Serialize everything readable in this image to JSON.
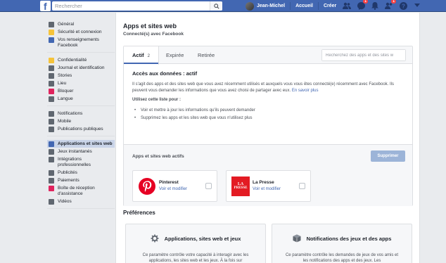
{
  "topbar": {
    "logo": "f",
    "search_placeholder": "Rechercher",
    "user_name": "Jean-Michel",
    "home": "Accueil",
    "create": "Créer",
    "icons": [
      "friends-icon",
      "messenger-icon",
      "notifications-icon",
      "help-icon",
      "menu-arrow-icon"
    ],
    "badge_messages": "1",
    "badge_notifications": "1"
  },
  "sidebar": {
    "groups": [
      [
        {
          "label": "Général",
          "icon": "gear-icon",
          "color": "#606770"
        },
        {
          "label": "Sécurité et connexion",
          "icon": "lock-icon",
          "color": "#f5c33b"
        },
        {
          "label": "Vos renseignements Facebook",
          "icon": "facebook-icon",
          "color": "#4267b2"
        }
      ],
      [
        {
          "label": "Confidentialité",
          "icon": "privacy-icon",
          "color": "#f5c33b"
        },
        {
          "label": "Journal et identification",
          "icon": "timeline-icon",
          "color": "#606770"
        },
        {
          "label": "Stories",
          "icon": "stories-icon",
          "color": "#606770"
        },
        {
          "label": "Lieu",
          "icon": "location-icon",
          "color": "#606770"
        },
        {
          "label": "Bloquer",
          "icon": "block-icon",
          "color": "#e0245e"
        },
        {
          "label": "Langue",
          "icon": "language-icon",
          "color": "#606770"
        }
      ],
      [
        {
          "label": "Notifications",
          "icon": "globe-icon",
          "color": "#606770"
        },
        {
          "label": "Mobile",
          "icon": "mobile-icon",
          "color": "#606770"
        },
        {
          "label": "Publications publiques",
          "icon": "rss-icon",
          "color": "#606770"
        }
      ],
      [
        {
          "label": "Applications et sites web",
          "icon": "apps-icon",
          "color": "#4267b2",
          "active": true
        },
        {
          "label": "Jeux instantanés",
          "icon": "games-icon",
          "color": "#606770"
        },
        {
          "label": "Intégrations professionnelles",
          "icon": "integrations-icon",
          "color": "#606770"
        },
        {
          "label": "Publicités",
          "icon": "ads-icon",
          "color": "#606770"
        },
        {
          "label": "Paiements",
          "icon": "payments-icon",
          "color": "#606770"
        },
        {
          "label": "Boîte de réception d'assistance",
          "icon": "support-icon",
          "color": "#e0245e"
        },
        {
          "label": "Vidéos",
          "icon": "videos-icon",
          "color": "#606770"
        }
      ]
    ]
  },
  "main": {
    "title": "Apps et sites web",
    "subtitle": "Connecté(s) avec Facebook",
    "tabs": [
      {
        "label": "Actif",
        "count": "2"
      },
      {
        "label": "Expirée"
      },
      {
        "label": "Retirée"
      }
    ],
    "search_placeholder": "Recherchez des apps et des sites w",
    "access_title": "Accès aux données : actif",
    "access_desc": "Il s'agit des apps et des sites web que vous avez récemment utilisés et auxquels vous vous êtes connecté(e) récemment avec Facebook. Ils peuvent vous demander les informations que vous avez choisi de partager avec eux.",
    "learn_more": "En savoir plus",
    "use_list_title": "Utilisez cette liste pour :",
    "use_list": [
      "Voir et mettre à jour les informations qu'ils peuvent demander",
      "Supprimez les apps et les sites web que vous n'utilisez plus"
    ],
    "active_apps_title": "Apps et sites web actifs",
    "remove_button": "Supprimer",
    "apps": [
      {
        "name": "Pinterest",
        "link": "Voir et modifier",
        "brand_color": "#e60023"
      },
      {
        "name": "La Presse",
        "link": "Voir et modifier",
        "logo_text_1": "LA",
        "logo_text_2": "PRESSE",
        "brand_color": "#e31b23"
      }
    ],
    "preferences_title": "Préférences",
    "pref_cards": [
      {
        "title": "Applications, sites web et jeux",
        "icon": "gear-icon",
        "text": "Ce paramètre contrôle votre capacité à interagir avec les applications, les sites web et les jeux. À la fois sur"
      },
      {
        "title": "Notifications des jeux et des apps",
        "icon": "box-icon",
        "text": "Ce paramètre contrôle les demandes de jeux de vos amis et les notifications des apps et des jeux. Les"
      }
    ]
  }
}
